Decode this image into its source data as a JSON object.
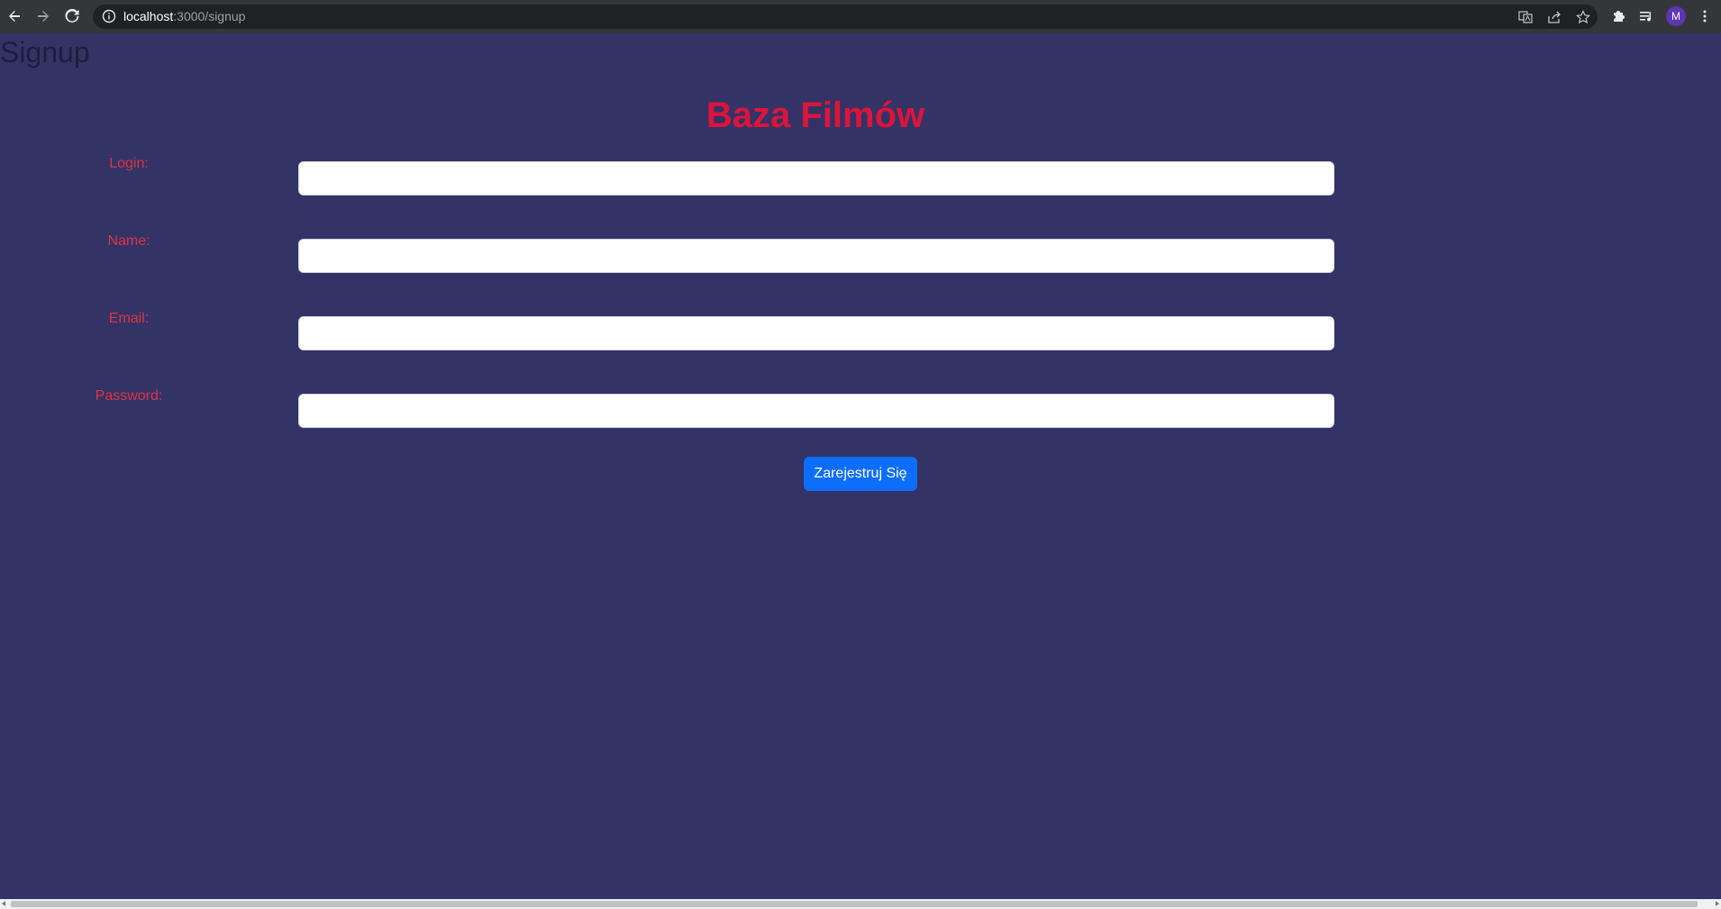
{
  "browser": {
    "url_host": "localhost",
    "url_path": ":3000/signup",
    "profile_initial": "M"
  },
  "page": {
    "heading": "Signup",
    "brand": "Baza Filmów"
  },
  "form": {
    "login_label": "Login:",
    "name_label": "Name:",
    "email_label": "Email:",
    "password_label": "Password:",
    "login_value": "",
    "name_value": "",
    "email_value": "",
    "password_value": "",
    "submit_label": "Zarejestruj Się"
  },
  "colors": {
    "background": "#333366",
    "label": "#dc3545",
    "brand": "#dc143c",
    "button": "#0d6efd"
  },
  "icons": {
    "back": "back-arrow-icon",
    "forward": "forward-arrow-icon",
    "reload": "reload-icon",
    "site_info": "info-icon",
    "translate": "translate-icon",
    "share": "share-icon",
    "bookmark": "star-icon",
    "extensions": "puzzle-icon",
    "media": "media-queue-icon",
    "menu": "kebab-menu-icon"
  }
}
